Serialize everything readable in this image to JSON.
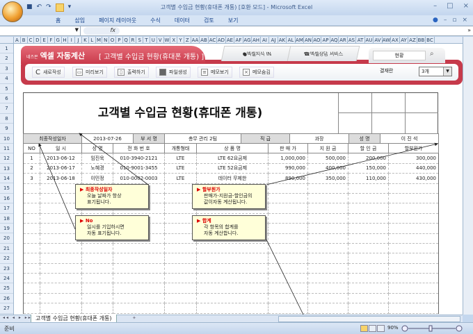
{
  "window": {
    "title": "고객별 수입금 현황(휴대폰 개통) [호환 모드] - Microsoft Excel"
  },
  "ribbon": {
    "tabs": [
      "홈",
      "삽입",
      "페이지 레이아웃",
      "수식",
      "데이터",
      "검토",
      "보기"
    ]
  },
  "formula_bar": {
    "fx": "fx",
    "name_box": "",
    "value": ""
  },
  "columns": [
    "A",
    "B",
    "C",
    "D",
    "E",
    "F",
    "G",
    "H",
    "I",
    "J",
    "K",
    "L",
    "M",
    "N",
    "O",
    "P",
    "Q",
    "R",
    "S",
    "T",
    "U",
    "V",
    "W",
    "X",
    "Y",
    "Z",
    "AA",
    "AB",
    "AC",
    "AD",
    "AE",
    "AF",
    "AG",
    "AH",
    "AI",
    "AJ",
    "AK",
    "AL",
    "AM",
    "AN",
    "AO",
    "AP",
    "AQ",
    "AR",
    "AS",
    "AT",
    "AU",
    "AV",
    "AW",
    "AX",
    "AY",
    "AZ",
    "BB",
    "BC"
  ],
  "rows": [
    "1",
    "2",
    "3",
    "4",
    "5",
    "6",
    "7",
    "8",
    "9",
    "10",
    "11",
    "12",
    "13",
    "14",
    "15",
    "16",
    "17",
    "18",
    "19",
    "20",
    "21",
    "22",
    "23",
    "24",
    "25",
    "26",
    "27"
  ],
  "banner": {
    "brand_small": "네즈몬",
    "brand": "엑셀 자동계산",
    "subtitle": "[ 고객별 수입금 현황(휴대폰 개통) ]",
    "links": [
      "엑셀지식 IN",
      "엑셀상담 서비스"
    ],
    "search_value": "현황",
    "buttons": [
      "새로작성",
      "미리보기",
      "출력하기",
      "파일생성",
      "메모보기",
      "메모숨김"
    ],
    "view_label": "결재란",
    "view_value": "3개"
  },
  "sheet": {
    "title": "고객별 수입금 현황(휴대폰 개통)",
    "info": {
      "date_label": "최종작성일자",
      "date": "2013-07-26",
      "dept_label": "부 서 명",
      "dept": "총무 관리 2팀",
      "rank_label": "직 급",
      "rank": "과장",
      "name_label": "성 명",
      "name": "이 진 석"
    },
    "headers": [
      "NO",
      "일 시",
      "성 명",
      "전 화 번 호",
      "개통형태",
      "상 품 명",
      "판 매 가",
      "지 원 금",
      "할 인 금",
      "할부원가"
    ],
    "records": [
      [
        "1",
        "2013-06-12",
        "임진욱",
        "010-3940-2121",
        "LTE",
        "LTE 62요금제",
        "1,000,000",
        "500,000",
        "200,000",
        "300,000"
      ],
      [
        "2",
        "2013-06-17",
        "노혜경",
        "010-9001-3455",
        "LTE",
        "LTE 52요금제",
        "990,000",
        "400,000",
        "150,000",
        "440,000"
      ],
      [
        "3",
        "2013-06-18",
        "이민정",
        "010-0002-0003",
        "LTE",
        "데이터 무제한",
        "890,000",
        "350,000",
        "110,000",
        "430,000"
      ]
    ]
  },
  "callouts": [
    {
      "title": "최종작성일자",
      "lines": [
        "오늘 날짜가 항상",
        "표기됩니다."
      ]
    },
    {
      "title": "No",
      "lines": [
        "일시를 기입하시면",
        "자동 표기됩니다."
      ]
    },
    {
      "title": "할부원가",
      "lines": [
        "판매가-지원금-할인금의",
        "값이자동 계산됩니다."
      ]
    },
    {
      "title": "합계",
      "lines": [
        "각 항목의 합계를",
        "자동 계산합니다."
      ]
    }
  ],
  "sheet_tab": "고객별 수입금 현황(휴대폰 개통)",
  "status": {
    "ready": "준비",
    "zoom": "90%"
  }
}
